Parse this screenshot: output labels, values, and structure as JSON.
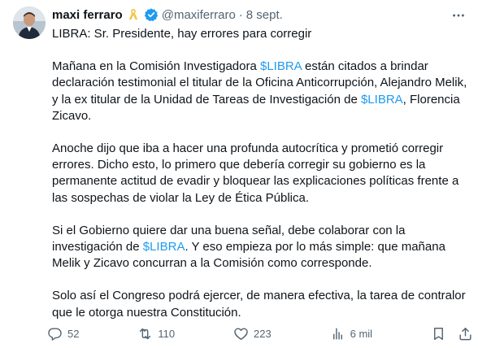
{
  "author": {
    "display_name": "maxi ferraro",
    "handle": "@maxiferraro",
    "separator": "·",
    "date": "8 sept."
  },
  "icons": {
    "ribbon": "yellow-ribbon-icon",
    "verified": "verified-badge-icon",
    "more": "more-options-icon"
  },
  "colors": {
    "accent": "#1d9bf0",
    "secondary": "#536471",
    "ribbon": "#f4c542"
  },
  "tweet": {
    "line1": "LIBRA: Sr. Presidente, hay errores para corregir",
    "p1": [
      {
        "t": "Mañana en la Comisión Investigadora "
      },
      {
        "t": "$LIBRA",
        "tag": true
      },
      {
        "t": " están citados a brindar declaración testimonial el titular de la Oficina Anticorrupción, Alejandro Melik, y la ex titular de la Unidad de Tareas de Investigación de "
      },
      {
        "t": "$LIBRA",
        "tag": true
      },
      {
        "t": ", Florencia Zicavo."
      }
    ],
    "p2": "Anoche dijo que iba a hacer una profunda autocrítica y prometió corregir errores. Dicho esto, lo primero que debería corregir su gobierno es la permanente actitud de evadir y bloquear las explicaciones políticas frente a las sospechas de violar la Ley de Ética Pública.",
    "p3": [
      {
        "t": "Si el Gobierno quiere dar una buena señal, debe colaborar con la investigación de "
      },
      {
        "t": "$LIBRA",
        "tag": true
      },
      {
        "t": ". Y eso empieza por lo más simple: que mañana Melik y Zicavo concurran a la Comisión como corresponde."
      }
    ],
    "p4": "Solo así el Congreso podrá ejercer, de manera efectiva, la tarea de contralor que le otorga nuestra Constitución."
  },
  "actions": {
    "replies": "52",
    "reposts": "110",
    "likes": "223",
    "views": "6 mil"
  }
}
